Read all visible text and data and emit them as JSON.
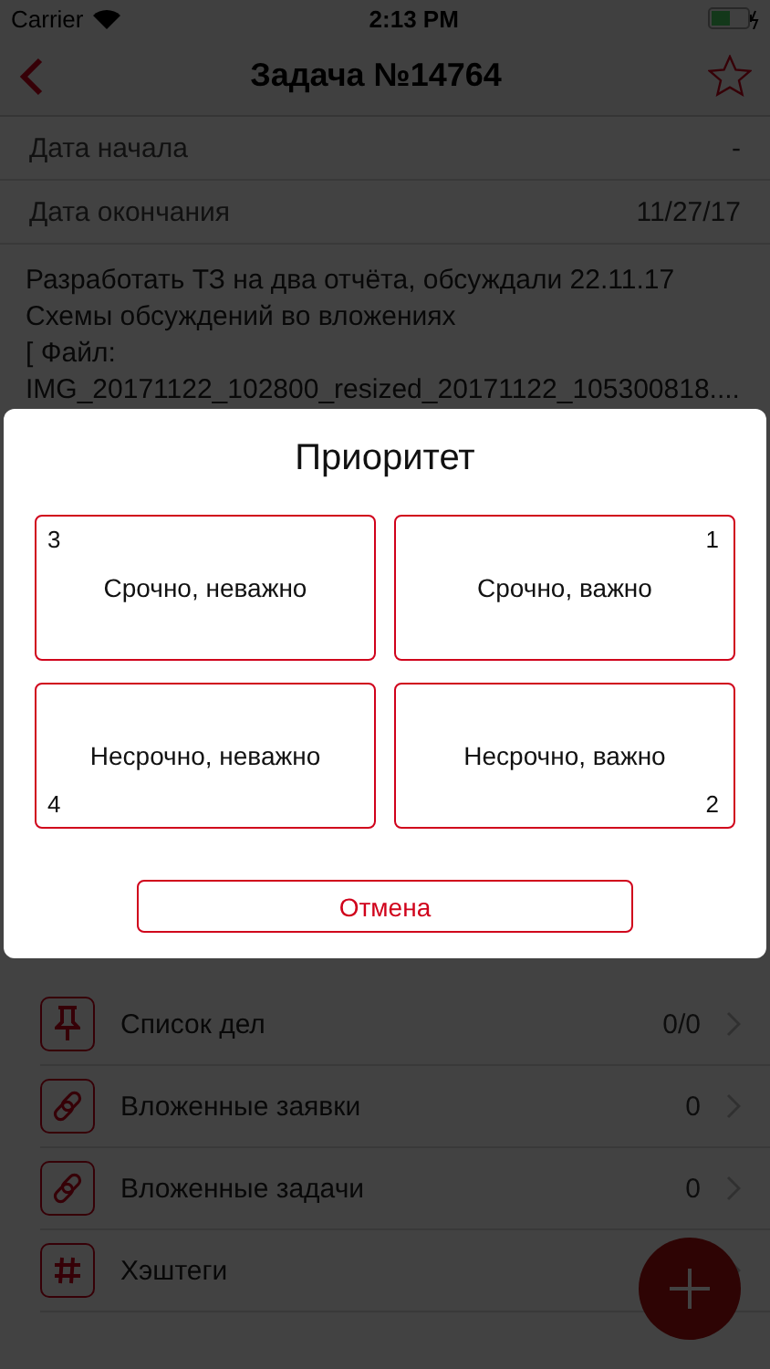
{
  "status_bar": {
    "carrier": "Carrier",
    "time": "2:13 PM"
  },
  "nav": {
    "title": "Задача №14764"
  },
  "fields": [
    {
      "label": "Дата начала",
      "value": "-"
    },
    {
      "label": "Дата окончания",
      "value": "11/27/17"
    }
  ],
  "description": [
    "Разработать ТЗ на два отчёта, обсуждали 22.11.17",
    "Схемы обсуждений во вложениях",
    "[ Файл:",
    "IMG_20171122_102800_resized_20171122_105300818...."
  ],
  "links": [
    {
      "kind": "pin",
      "label": "Список дел",
      "count": "0/0"
    },
    {
      "kind": "link",
      "label": "Вложенные заявки",
      "count": "0"
    },
    {
      "kind": "link",
      "label": "Вложенные задачи",
      "count": "0"
    },
    {
      "kind": "hash",
      "label": "Хэштеги"
    }
  ],
  "dialog": {
    "title": "Приоритет",
    "options": [
      {
        "label": "Срочно, неважно",
        "number": "3"
      },
      {
        "label": "Срочно, важно",
        "number": "1"
      },
      {
        "label": "Несрочно, неважно",
        "number": "4"
      },
      {
        "label": "Несрочно, важно",
        "number": "2"
      }
    ],
    "cancel": "Отмена"
  }
}
